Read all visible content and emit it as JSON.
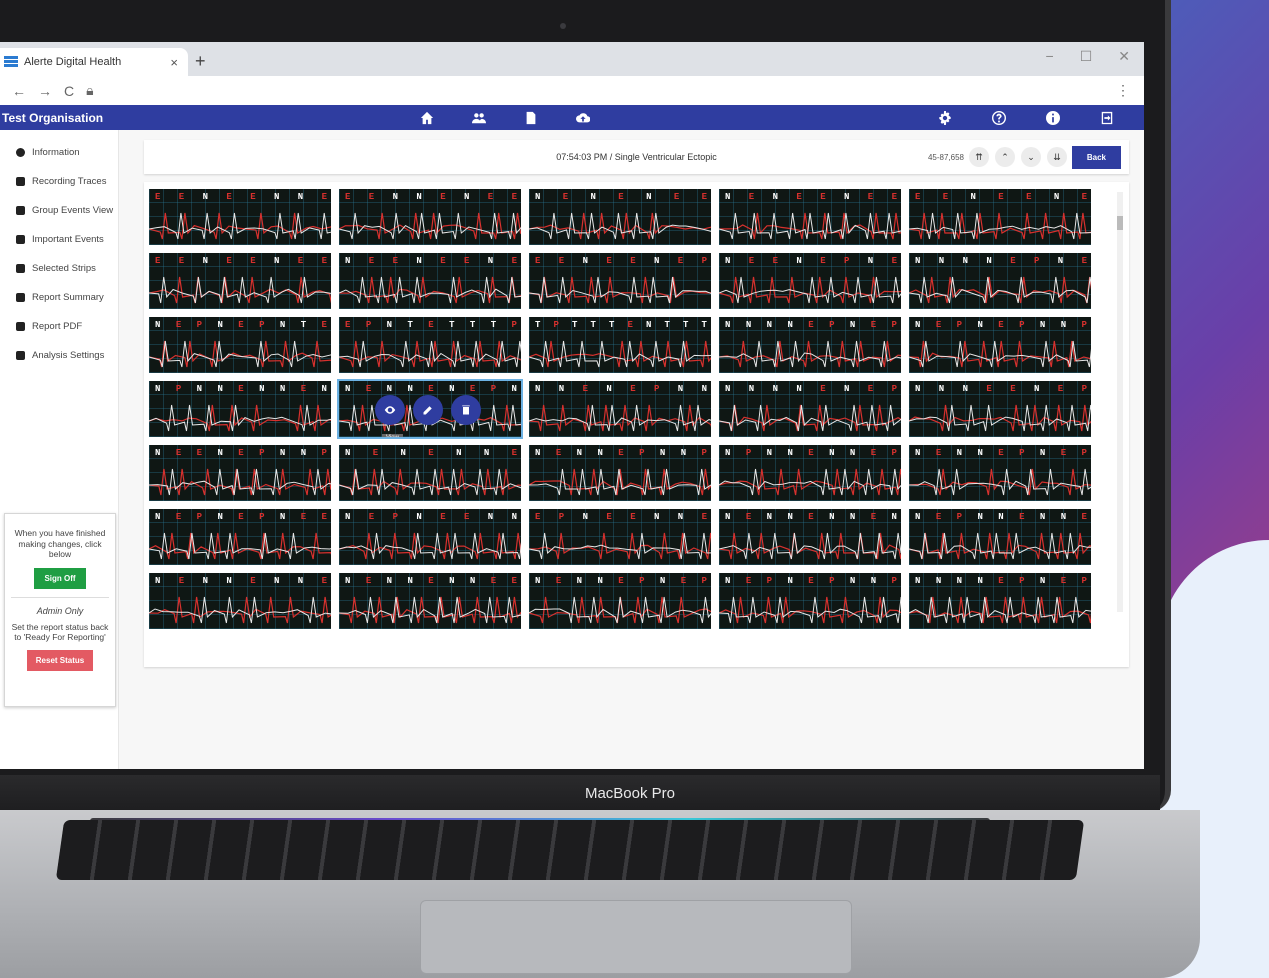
{
  "browser": {
    "tab_title": "Alerte Digital Health",
    "tab_close": "×",
    "new_tab": "+",
    "window_controls": [
      "−",
      "☐",
      "✕"
    ]
  },
  "app": {
    "org_name": "Test Organisation",
    "brand_color": "#2f3da0"
  },
  "nav": {
    "center_icons": [
      "home-icon",
      "users-icon",
      "document-icon",
      "cloud-upload-icon"
    ],
    "right_icons": [
      "gear-icon",
      "help-icon",
      "info-icon",
      "logout-icon"
    ]
  },
  "sidebar": {
    "items": [
      {
        "label": "Information",
        "icon": "info-icon"
      },
      {
        "label": "Recording Traces",
        "icon": "heart-pulse-icon"
      },
      {
        "label": "Group Events View",
        "icon": "grid-icon"
      },
      {
        "label": "Important Events",
        "icon": "flag-icon"
      },
      {
        "label": "Selected Strips",
        "icon": "square-icon"
      },
      {
        "label": "Report Summary",
        "icon": "report-icon"
      },
      {
        "label": "Report PDF",
        "icon": "pdf-icon"
      },
      {
        "label": "Analysis Settings",
        "icon": "sliders-icon"
      }
    ],
    "signoff_message": "When you have finished making changes, click below",
    "signoff_button": "Sign Off",
    "admin_label": "Admin Only",
    "reset_message": "Set the report status back to 'Ready For Reporting'",
    "reset_button": "Reset Status"
  },
  "toolbar": {
    "title": "07:54:03 PM / Single Ventricular Ectopic",
    "counter": "45-87,658",
    "nav_buttons": [
      "first-page-icon",
      "prev-icon",
      "next-icon",
      "last-page-icon"
    ],
    "back_label": "Back"
  },
  "hover": {
    "tooltip": "View"
  },
  "laptop": {
    "model": "MacBook Pro"
  },
  "strips": [
    [
      "E E N E E N N E",
      "E E N N E N E E",
      "N E N E N E E",
      "N E N E E N E E",
      "E E N E E N E"
    ],
    [
      "E E N E E N E E",
      "N E E N E E N E",
      "E E N E E N E P",
      "N E E N E P N E",
      "N N N N E P N E"
    ],
    [
      "N E P N E P N T E",
      "E P N T E T T T P",
      "T P T T T E N T T T",
      "N N N N E P N E P",
      "N E P N E P N N P"
    ],
    [
      "N P N N E N N E N",
      "N E N N E N E P N",
      "N N E N E P N N",
      "N N N N E N E P",
      "N N N E E N E P"
    ],
    [
      "N E E N E P N N P",
      "N E N E N N E",
      "N E N N E P N N P",
      "N P N N E N N E P",
      "N E N N E P N E P"
    ],
    [
      "N E P N E P N E E",
      "N E P N E E N N",
      "E P N E E N N E",
      "N E N N E N N E N",
      "N E P N N E N N E"
    ],
    [
      "N E N N E N N E",
      "N E N N E N N E E",
      "N E N N E P N E P",
      "N E P N E P N N P",
      "N N N N E P N E P"
    ]
  ]
}
